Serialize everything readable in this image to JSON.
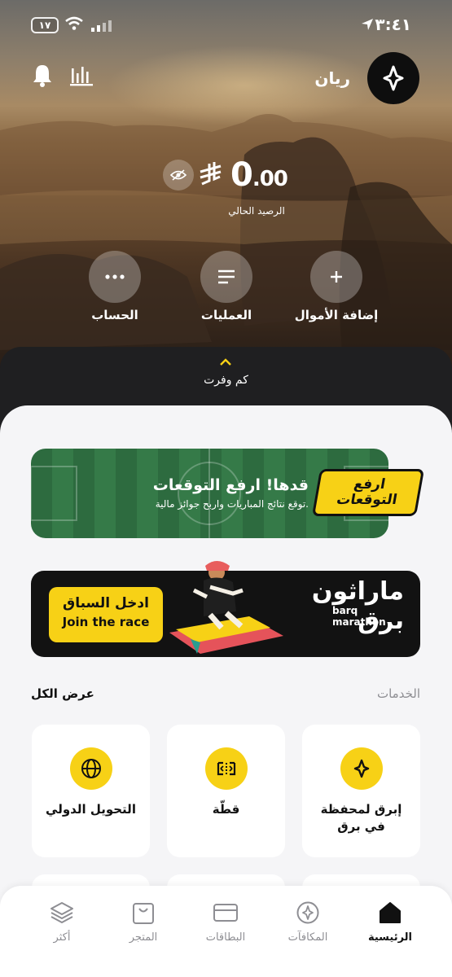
{
  "status_bar": {
    "time": "٣:٤١",
    "battery": "١٧"
  },
  "header": {
    "user_name": "ريان",
    "avatar_icon": "barq-logo-icon",
    "notifications_icon": "bell-icon",
    "stats_icon": "bar-chart-icon"
  },
  "balance": {
    "amount_main": "0",
    "amount_decimal": ".00",
    "currency_icon": "riyal-symbol-icon",
    "label": "الرصيد الحالي",
    "hide_icon": "eye-off-icon"
  },
  "actions": [
    {
      "label": "إضافة الأموال",
      "icon": "plus-icon"
    },
    {
      "label": "العمليات",
      "icon": "list-icon"
    },
    {
      "label": "الحساب",
      "icon": "more-icon"
    }
  ],
  "savings": {
    "label": "كم وفرت"
  },
  "banner_predictions": {
    "logo_line1": "ارفع",
    "logo_line2": "التوقعات",
    "title": "قدها! ارفع التوقعات",
    "subtitle": "توقع نتائج المباريات واربح جوائز مالية."
  },
  "banner_marathon": {
    "cta_ar": "ادخل السباق",
    "cta_en": "Join the race",
    "title_ar_1": "ماراثون",
    "title_ar_2": "برق",
    "title_en_1": "barq",
    "title_en_2": "marathon"
  },
  "services": {
    "title": "الخدمات",
    "view_all": "عرض الكل",
    "items": [
      {
        "label": "إبرق لمحفظة في برق",
        "icon": "barq-spark-icon"
      },
      {
        "label": "قطّة",
        "icon": "split-bill-icon"
      },
      {
        "label": "التحويل الدولي",
        "icon": "globe-icon"
      }
    ]
  },
  "nav": {
    "items": [
      {
        "label": "الرئيسية",
        "icon": "home-icon",
        "active": true
      },
      {
        "label": "المكافآت",
        "icon": "rewards-icon",
        "active": false
      },
      {
        "label": "البطاقات",
        "icon": "card-icon",
        "active": false
      },
      {
        "label": "المتجر",
        "icon": "shopping-bag-icon",
        "active": false
      },
      {
        "label": "أكثر",
        "icon": "layers-icon",
        "active": false
      }
    ]
  },
  "colors": {
    "accent": "#f7d116",
    "sheet_bg": "#f5f5f7",
    "text_primary": "#111111",
    "text_muted": "#8e8e93"
  }
}
